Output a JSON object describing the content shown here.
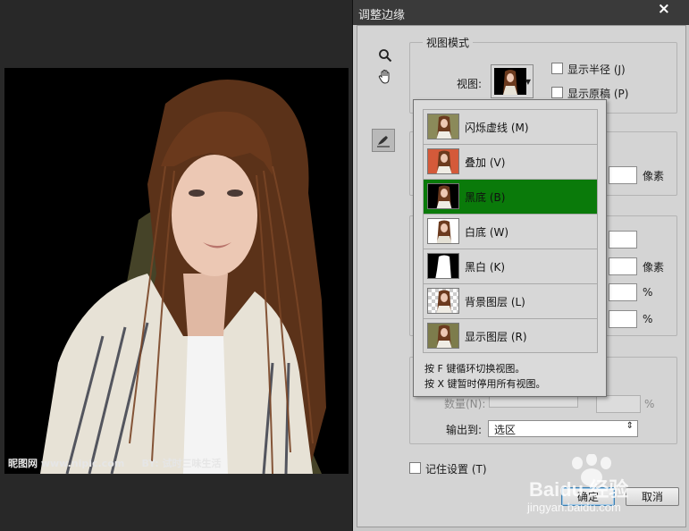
{
  "canvas": {
    "watermark_left": "昵图网 www.nipic.com",
    "watermark_right": "BY: 试时三味生活"
  },
  "dialog": {
    "title": "调整边缘",
    "close_glyph": "×",
    "view_mode": {
      "group_title": "视图模式",
      "view_label": "视图:",
      "show_radius_label": "显示半径 (J)",
      "show_original_label": "显示原稿 (P)"
    },
    "edge_detection": {
      "radius_unit": "像素"
    },
    "adjust_edge": {
      "feather_unit": "像素",
      "contrast_unit": "%",
      "shift_unit": "%"
    },
    "output": {
      "amount_label": "数量(N):",
      "amount_unit": "%",
      "output_to_label": "输出到:",
      "output_to_value": "选区"
    },
    "remember_label": "记住设置 (T)",
    "ok_label": "确定",
    "cancel_label": "取消"
  },
  "view_menu": {
    "items": [
      {
        "label": "闪烁虚线 (M)",
        "thumb": "photo"
      },
      {
        "label": "叠加 (V)",
        "thumb": "overlay-red"
      },
      {
        "label": "黑底 (B)",
        "thumb": "on-black",
        "selected": true
      },
      {
        "label": "白底 (W)",
        "thumb": "on-white"
      },
      {
        "label": "黑白 (K)",
        "thumb": "black-white-mask"
      },
      {
        "label": "背景图层 (L)",
        "thumb": "checker-layer"
      },
      {
        "label": "显示图层 (R)",
        "thumb": "photo"
      }
    ],
    "hint_1": "按 F 键循环切换视图。",
    "hint_2": "按 X 键暂时停用所有视图。"
  },
  "site_watermark": {
    "text": "Baidu 经验",
    "url": "jingyan.baidu.com"
  },
  "colors": {
    "selected_item": "#0a7a0a",
    "titlebar": "#3a3a3a",
    "dialog_bg": "#d4d4d4",
    "hair": "#6b3a1e"
  }
}
